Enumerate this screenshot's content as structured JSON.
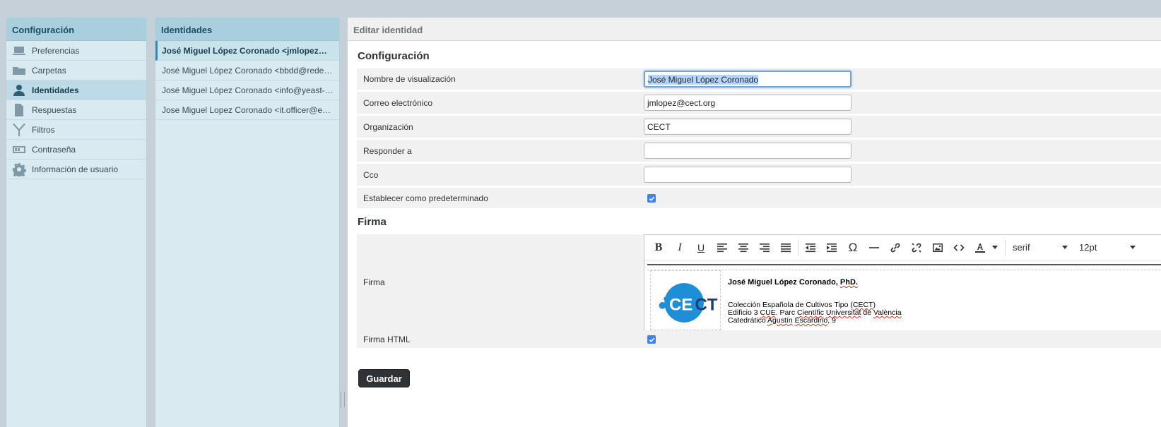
{
  "settings": {
    "title": "Configuración",
    "items": [
      {
        "label": "Preferencias",
        "icon": "laptop-icon"
      },
      {
        "label": "Carpetas",
        "icon": "folder-icon"
      },
      {
        "label": "Identidades",
        "icon": "user-icon",
        "active": true
      },
      {
        "label": "Respuestas",
        "icon": "document-icon"
      },
      {
        "label": "Filtros",
        "icon": "filter-icon"
      },
      {
        "label": "Contraseña",
        "icon": "password-icon"
      },
      {
        "label": "Información de usuario",
        "icon": "gear-icon"
      }
    ]
  },
  "identities": {
    "title": "Identidades",
    "items": [
      "José Miguel López Coronado <jmlopez@cect.org>",
      "José Miguel López Coronado <bbdd@redes.cect.org>",
      "José Miguel López Coronado <info@yeast-identification.org>",
      "Jose Miguel Lopez Coronado <it.officer@ecco.org>"
    ]
  },
  "edit": {
    "title": "Editar identidad",
    "section_config": "Configuración",
    "display_name_label": "Nombre de visualización",
    "display_name_value": "José Miguel López Coronado",
    "email_label": "Correo electrónico",
    "email_value": "jmlopez@cect.org",
    "org_label": "Organización",
    "org_value": "CECT",
    "reply_to_label": "Responder a",
    "reply_to_value": "",
    "bcc_label": "Cco",
    "bcc_value": "",
    "default_label": "Establecer como predeterminado",
    "default_checked": true,
    "section_signature": "Firma",
    "signature_label": "Firma",
    "html_signature_label": "Firma HTML",
    "html_signature_checked": true,
    "save_label": "Guardar"
  },
  "editor": {
    "font_family": "serif",
    "font_size": "12pt",
    "toolbar_icons": [
      "bold-icon",
      "italic-icon",
      "underline-icon",
      "align-left-icon",
      "align-center-icon",
      "align-right-icon",
      "align-justify-icon",
      "outdent-icon",
      "indent-icon",
      "special-char-icon",
      "horizontal-rule-icon",
      "link-icon",
      "unlink-icon",
      "image-icon",
      "code-icon",
      "text-color-icon"
    ],
    "signature": {
      "name": "José Miguel López Coronado, ",
      "title": "PhD.",
      "org_prefix": "Colección Española de Cultivos Tipo (",
      "org_abbr": "CECT",
      "org_suffix": ")",
      "addr1_prefix": "Edificio 3 ",
      "addr1_cue": "CUE",
      "addr1_mid": ". Parc ",
      "addr1_cientific": "Científic",
      "addr1_univ": "Universitat",
      "addr1_de": " de ",
      "addr1_valencia": "València",
      "addr2_prefix": "Catedrático ",
      "addr2_agustin": "Agustín",
      "addr2_escardino": "Escardino",
      "addr2_suffix": ", 9",
      "logo_text": "CECT"
    }
  }
}
